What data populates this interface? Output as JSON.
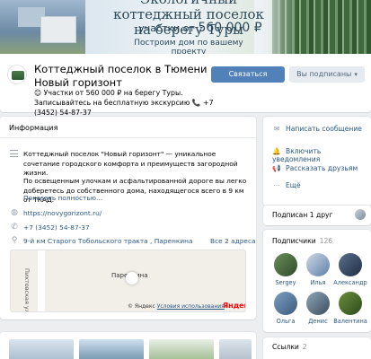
{
  "cover": {
    "title": "Экологичный коттеджный поселок на берегу Туры",
    "price_prefix": "участки от",
    "price": "560 000 ₽",
    "cta": "Построим дом по вашему проекту"
  },
  "group": {
    "title": "Коттеджный поселок в Тюмени Новый горизонт",
    "status": "😊 Участки от 560 000 ₽ на берегу Туры. Записывайтесь на бесплатную экскурсию 📞 +7 (3452) 54-87-37",
    "subscribe_label": "Связаться",
    "subscribed_label": "Вы подписаны",
    "subscribed_icon": "chevron-down-icon"
  },
  "info": {
    "header": "Информация",
    "description_1": "Коттеджный поселок \"Новый горизонт\" — уникальное сочетание городского комфорта и преимуществ загородной жизни.",
    "description_2": "По освещенным улочкам и асфальтированной дороге вы легко доберетесь до собственного дома, находящегося всего в 9 км от ТКАД.",
    "more": "Показать полностью…",
    "website": "https://novygorizont.ru/",
    "phone": "+7 (3452) 54-87-37",
    "address": "9-й км Старого Тобольского тракта , Паренкина",
    "addresses_link": "Все 2 адреса",
    "map": {
      "road_label": "Пихтовская ул.",
      "place_label": "Паренкина",
      "copyright": "© Яндекс",
      "terms": "Условия использования",
      "logo": "Яндекс"
    }
  },
  "actions": [
    {
      "icon": "message-icon",
      "label": "Написать сообщение"
    },
    {
      "icon": "bell-icon",
      "label": "Включить уведомления"
    },
    {
      "icon": "megaphone-icon",
      "label": "Рассказать друзьям"
    },
    {
      "icon": "more-icon",
      "label": "Ещё"
    }
  ],
  "friends": {
    "label": "Подписан 1 друг"
  },
  "members": {
    "title": "Подписчики",
    "count": "126",
    "items": [
      {
        "name": "Sergey"
      },
      {
        "name": "Илья"
      },
      {
        "name": "Александр"
      },
      {
        "name": "Ольга"
      },
      {
        "name": "Денис"
      },
      {
        "name": "Валентина"
      }
    ]
  },
  "links": {
    "title": "Ссылки",
    "count": "2"
  },
  "colors": {
    "accent": "#5181b8",
    "link": "#2a5885",
    "background": "#edeef0"
  }
}
